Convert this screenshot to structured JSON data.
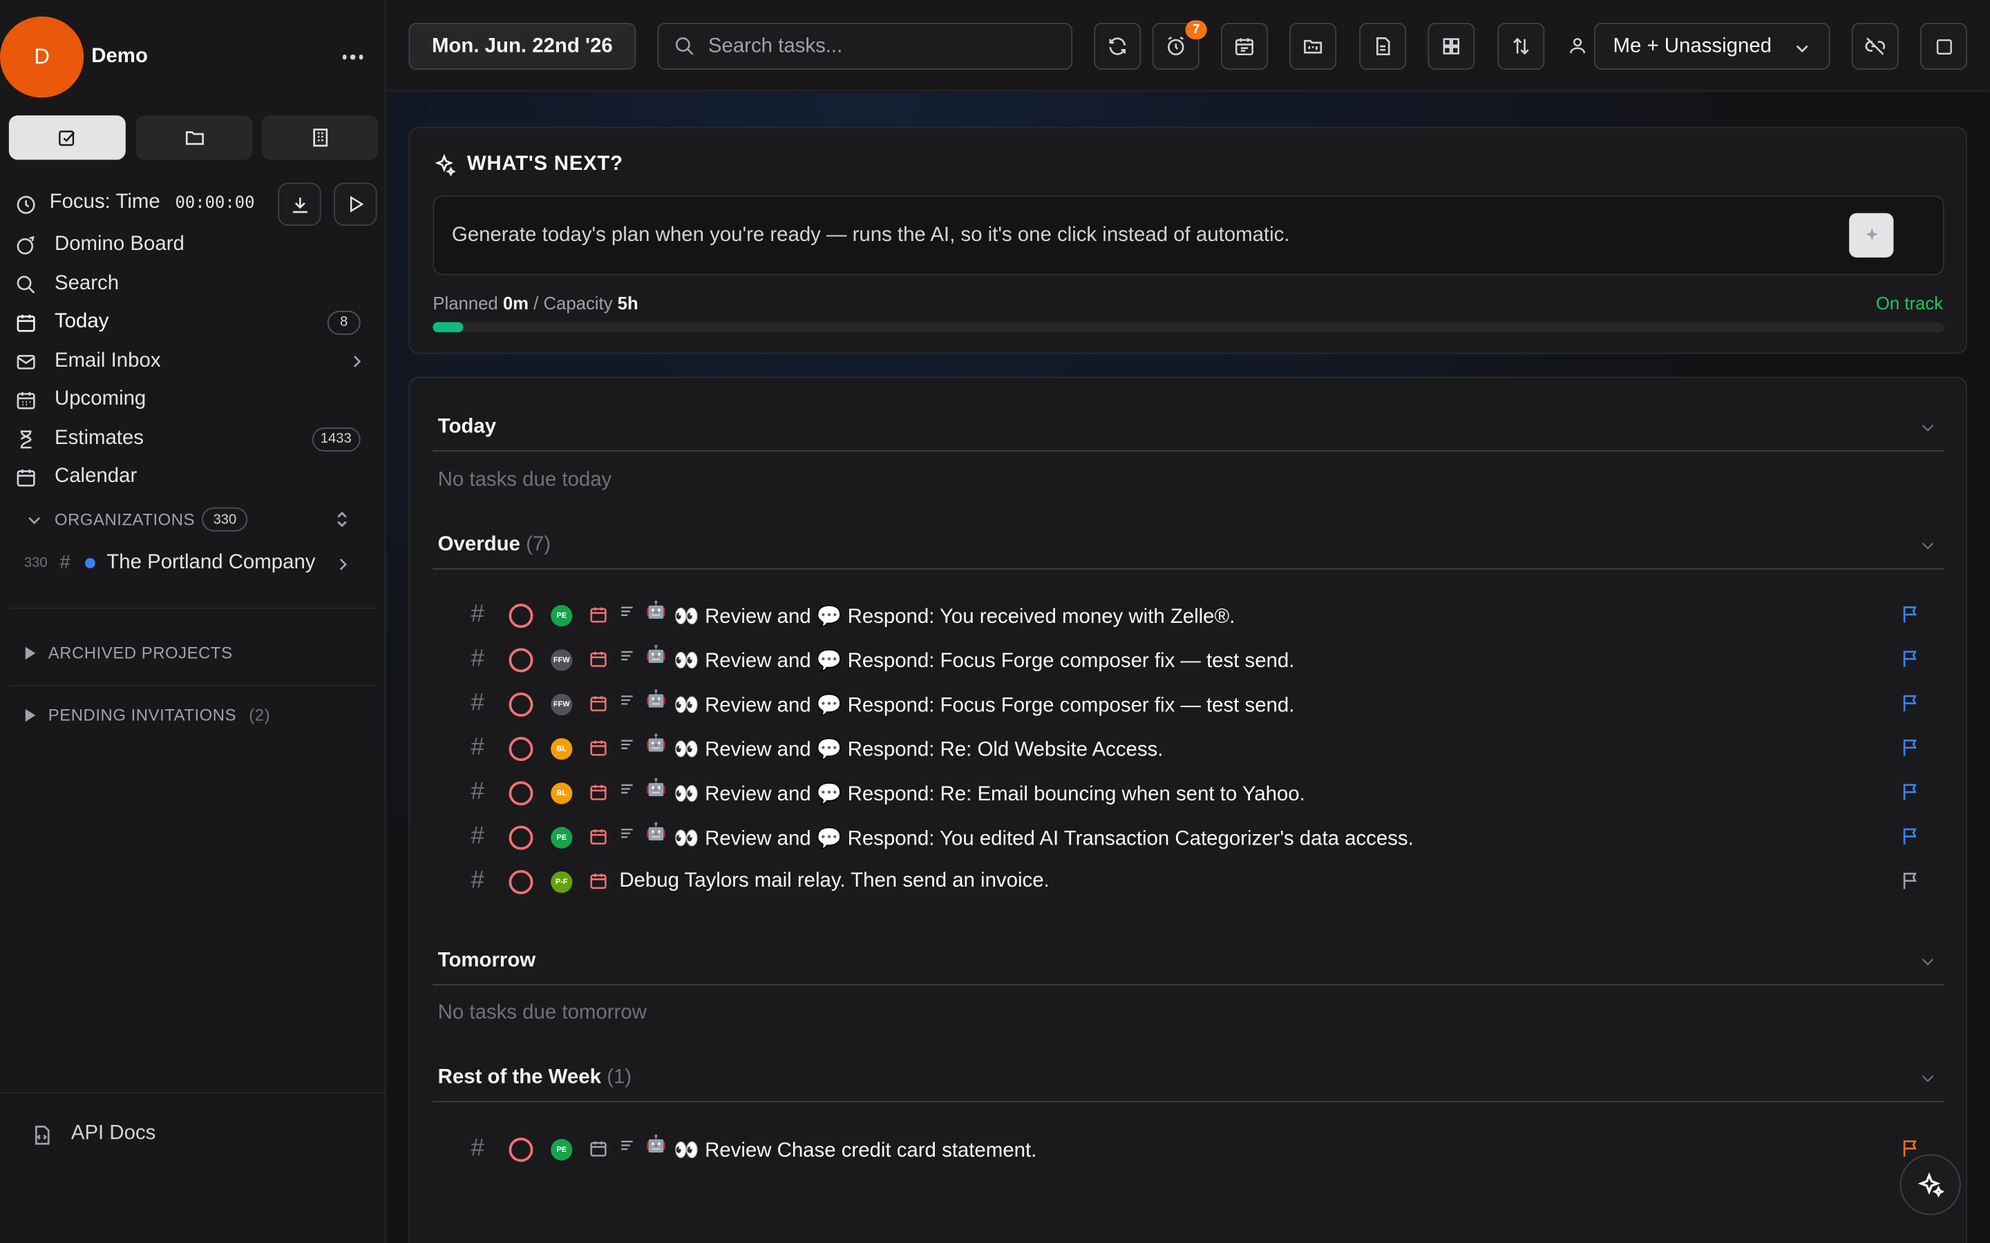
{
  "workspace": {
    "initial": "D",
    "name": "Demo"
  },
  "nav": {
    "focus_label": "Focus: Time",
    "focus_time": "00:00:00",
    "items": [
      {
        "label": "Domino Board"
      },
      {
        "label": "Search"
      },
      {
        "label": "Today",
        "count": "8"
      },
      {
        "label": "Email Inbox"
      },
      {
        "label": "Upcoming"
      },
      {
        "label": "Estimates",
        "count": "1433"
      },
      {
        "label": "Calendar"
      }
    ],
    "organizations_label": "ORGANIZATIONS",
    "organizations_count": "330",
    "org": {
      "count": "330",
      "name": "The Portland Company"
    },
    "archived_label": "ARCHIVED PROJECTS",
    "pending_label": "PENDING INVITATIONS",
    "pending_count": "(2)",
    "api_docs": "API Docs"
  },
  "topbar": {
    "date": "Mon. Jun. 22nd '26",
    "search_placeholder": "Search tasks...",
    "reminder_badge": "7",
    "assignee": "Me + Unassigned"
  },
  "whats_next": {
    "title": "WHAT'S NEXT?",
    "prompt": "Generate today's plan when you're ready — runs the AI, so it's one click instead of automatic.",
    "planned_label": "Planned",
    "planned_value": "0m",
    "capacity_label": "Capacity",
    "capacity_value": "5h",
    "status": "On track",
    "progress": 0.02
  },
  "groups": {
    "today": {
      "title": "Today",
      "empty": "No tasks due today"
    },
    "overdue": {
      "title": "Overdue",
      "count": "(7)"
    },
    "tomorrow": {
      "title": "Tomorrow",
      "empty": "No tasks due tomorrow"
    },
    "rest": {
      "title": "Rest of the Week",
      "count": "(1)"
    }
  },
  "overdue_tasks": [
    {
      "avatar": "PE",
      "review": "Review and",
      "respond": "Respond: You received money with Zelle®."
    },
    {
      "avatar": "FFW",
      "review": "Review and",
      "respond": "Respond: Focus Forge composer fix — test send."
    },
    {
      "avatar": "FFW",
      "review": "Review and",
      "respond": "Respond: Focus Forge composer fix — test send."
    },
    {
      "avatar": "BL",
      "review": "Review and",
      "respond": "Respond: Re: Old Website Access."
    },
    {
      "avatar": "BL",
      "review": "Review and",
      "respond": "Respond: Re: Email bouncing when sent to Yahoo."
    },
    {
      "avatar": "PE",
      "review": "Review and",
      "respond": "Respond: You edited AI Transaction Categorizer's data access."
    },
    {
      "avatar": "P-F",
      "title": "Debug Taylors mail relay. Then send an invoice."
    }
  ],
  "week_tasks": [
    {
      "avatar": "PE",
      "title": "Review Chase credit card statement."
    }
  ],
  "colors": {
    "accent_orange": "#ea580c",
    "on_track": "#22c55e",
    "overdue_circle": "#f87171",
    "flag_blue": "#3b82f6",
    "flag_orange": "#f97316"
  }
}
